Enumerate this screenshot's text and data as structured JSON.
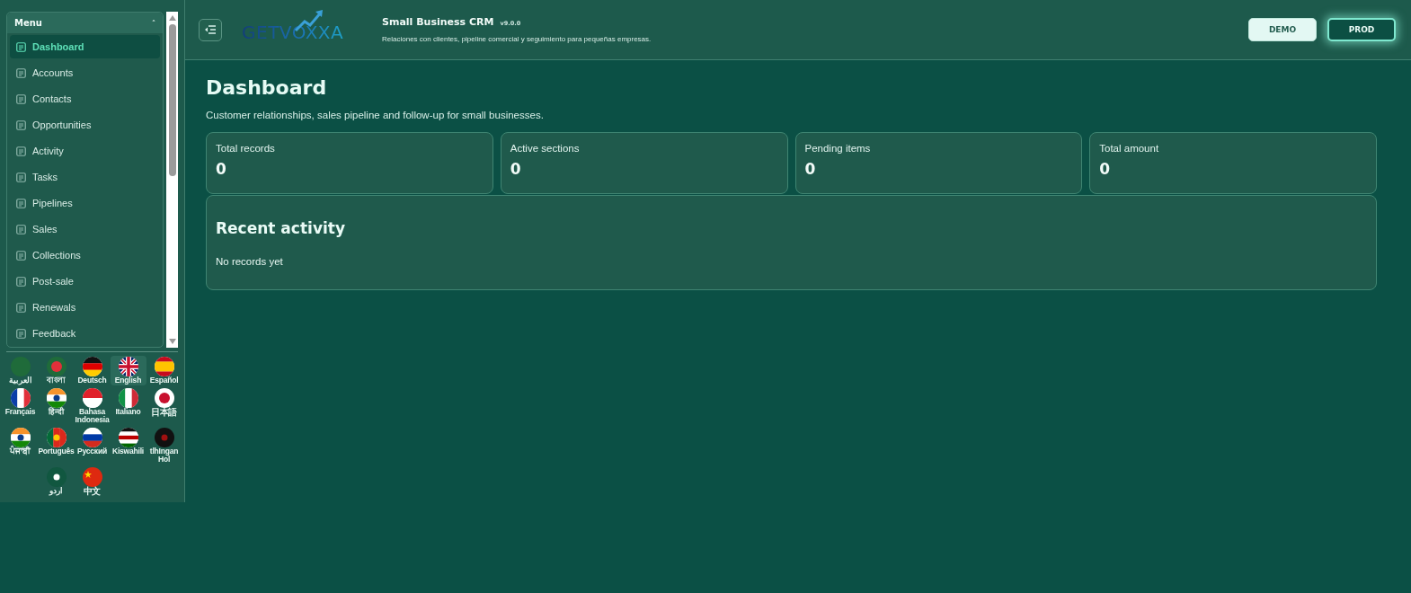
{
  "sidebar": {
    "menu_title": "Menu",
    "collapse_glyph": "˄",
    "items": [
      {
        "label": "Dashboard",
        "selected": true
      },
      {
        "label": "Accounts",
        "selected": false
      },
      {
        "label": "Contacts",
        "selected": false
      },
      {
        "label": "Opportunities",
        "selected": false
      },
      {
        "label": "Activity",
        "selected": false
      },
      {
        "label": "Tasks",
        "selected": false
      },
      {
        "label": "Pipelines",
        "selected": false
      },
      {
        "label": "Sales",
        "selected": false
      },
      {
        "label": "Collections",
        "selected": false
      },
      {
        "label": "Post-sale",
        "selected": false
      },
      {
        "label": "Renewals",
        "selected": false
      },
      {
        "label": "Feedback",
        "selected": false
      }
    ],
    "languages": [
      {
        "label": "العربية",
        "selected": false
      },
      {
        "label": "বাংলা",
        "selected": false
      },
      {
        "label": "Deutsch",
        "selected": false
      },
      {
        "label": "English",
        "selected": true
      },
      {
        "label": "Español",
        "selected": false
      },
      {
        "label": "Français",
        "selected": false
      },
      {
        "label": "हिन्दी",
        "selected": false
      },
      {
        "label": "Bahasa Indonesia",
        "selected": false
      },
      {
        "label": "Italiano",
        "selected": false
      },
      {
        "label": "日本語",
        "selected": false
      },
      {
        "label": "ਪੰਜਾਬੀ",
        "selected": false
      },
      {
        "label": "Português",
        "selected": false
      },
      {
        "label": "Русский",
        "selected": false
      },
      {
        "label": "Kiswahili",
        "selected": false
      },
      {
        "label": "tlhIngan Hol",
        "selected": false
      },
      {
        "label": "اردو",
        "selected": false
      },
      {
        "label": "中文",
        "selected": false
      }
    ]
  },
  "header": {
    "logo": "GETVOXXA",
    "app_name": "Small Business CRM",
    "version": "v9.0.0",
    "tagline": "Relaciones con clientes, pipeline comercial y seguimiento para pequeñas empresas.",
    "environments": [
      {
        "label": "DEMO",
        "selected": false
      },
      {
        "label": "PROD",
        "selected": true
      }
    ]
  },
  "page": {
    "title": "Dashboard",
    "subtitle": "Customer relationships, sales pipeline and follow-up for small businesses.",
    "stats": [
      {
        "label": "Total records",
        "value": "0"
      },
      {
        "label": "Active sections",
        "value": "0"
      },
      {
        "label": "Pending items",
        "value": "0"
      },
      {
        "label": "Total amount",
        "value": "0"
      }
    ],
    "recent": {
      "title": "Recent activity",
      "empty": "No records yet"
    }
  }
}
